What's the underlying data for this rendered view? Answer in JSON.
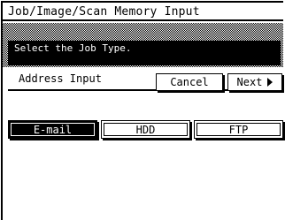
{
  "title": "Job/Image/Scan Memory Input",
  "message": "Select the Job Type.",
  "subheader": {
    "label": "Address Input",
    "cancel_label": "Cancel",
    "next_label": "Next"
  },
  "job_types": [
    {
      "label": "E-mail",
      "selected": true
    },
    {
      "label": "HDD",
      "selected": false
    },
    {
      "label": "FTP",
      "selected": false
    }
  ],
  "colors": {
    "foreground": "#000000",
    "background": "#ffffff"
  }
}
